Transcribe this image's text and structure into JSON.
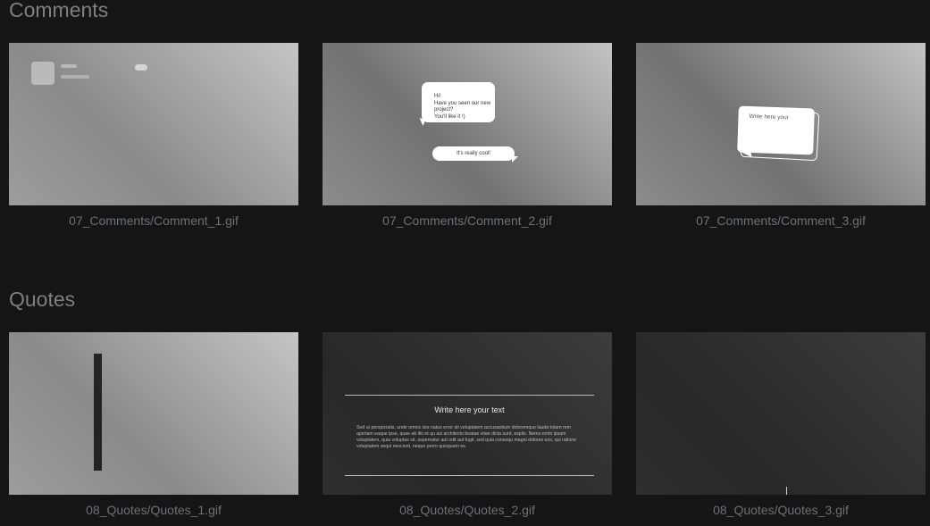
{
  "sections": [
    {
      "title": "Comments",
      "items": [
        {
          "caption": "07_Comments/Comment_1.gif"
        },
        {
          "caption": "07_Comments/Comment_2.gif",
          "bubble_text_lines": [
            "Hi!",
            "Have you seen our new",
            "project?",
            "You'll like it !)"
          ],
          "reply_text": "It's really cool!"
        },
        {
          "caption": "07_Comments/Comment_3.gif",
          "bubble_text": "Write  here  your"
        }
      ]
    },
    {
      "title": "Quotes",
      "items": [
        {
          "caption": "08_Quotes/Quotes_1.gif"
        },
        {
          "caption": "08_Quotes/Quotes_2.gif",
          "quote_title": "Write here your text",
          "quote_body": "Sed ut perspiciatis, unde omnis iste natus error sit voluptatem accusantium doloremque lauda totam rem aperiam eaque ipsa, quae ab illo et qu asi architecto beatae vitae dicta sunt, explio. Nemo enim ipsam voluptatem, quia voluptas sit, aspernatur aut odit aut fugit, sed quia consequ magni dolores eos, qui ratione voluptatem sequi nesciunt, neque porro quisquam es."
        },
        {
          "caption": "08_Quotes/Quotes_3.gif"
        }
      ]
    }
  ],
  "colors": {
    "background": "#141516",
    "section_title": "#7d7f81",
    "caption": "#6e7174"
  }
}
